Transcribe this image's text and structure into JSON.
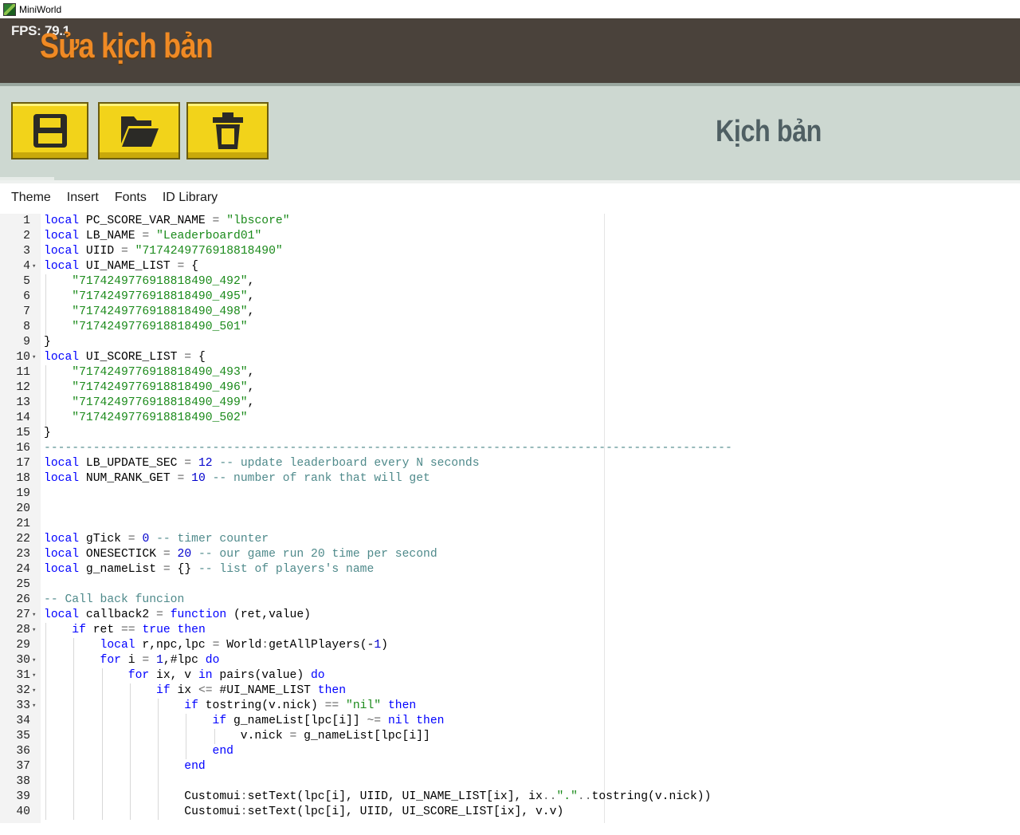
{
  "window": {
    "title": "MiniWorld"
  },
  "header": {
    "fps": "FPS: 79.1",
    "title": "Sửa kịch bản"
  },
  "toolbar": {
    "buttons": [
      {
        "name": "save",
        "icon": "floppy-disk-icon"
      },
      {
        "name": "open",
        "icon": "folder-open-icon"
      },
      {
        "name": "delete",
        "icon": "trash-icon"
      }
    ],
    "section_label": "Kịch bản"
  },
  "menu": [
    "Theme",
    "Insert",
    "Fonts",
    "ID Library"
  ],
  "colors": {
    "header_bg": "#4a423b",
    "title_orange": "#f08a24",
    "toolbar_bg": "#cdd8d1",
    "button_yellow": "#f2d31a",
    "keyword": "#0000ff",
    "string": "#1a8a1a",
    "comment": "#4f8a8b"
  },
  "code": {
    "lines": [
      {
        "n": 1,
        "fold": false,
        "text": "local PC_SCORE_VAR_NAME = \"lbscore\""
      },
      {
        "n": 2,
        "fold": false,
        "text": "local LB_NAME = \"Leaderboard01\""
      },
      {
        "n": 3,
        "fold": false,
        "text": "local UIID = \"7174249776918818490\""
      },
      {
        "n": 4,
        "fold": true,
        "text": "local UI_NAME_LIST = {"
      },
      {
        "n": 5,
        "fold": false,
        "text": "    \"7174249776918818490_492\","
      },
      {
        "n": 6,
        "fold": false,
        "text": "    \"7174249776918818490_495\","
      },
      {
        "n": 7,
        "fold": false,
        "text": "    \"7174249776918818490_498\","
      },
      {
        "n": 8,
        "fold": false,
        "text": "    \"7174249776918818490_501\""
      },
      {
        "n": 9,
        "fold": false,
        "text": "}"
      },
      {
        "n": 10,
        "fold": true,
        "text": "local UI_SCORE_LIST = {"
      },
      {
        "n": 11,
        "fold": false,
        "text": "    \"7174249776918818490_493\","
      },
      {
        "n": 12,
        "fold": false,
        "text": "    \"7174249776918818490_496\","
      },
      {
        "n": 13,
        "fold": false,
        "text": "    \"7174249776918818490_499\","
      },
      {
        "n": 14,
        "fold": false,
        "text": "    \"7174249776918818490_502\""
      },
      {
        "n": 15,
        "fold": false,
        "text": "}"
      },
      {
        "n": 16,
        "fold": false,
        "text": "--------------------------------------------------------------------------------------------------"
      },
      {
        "n": 17,
        "fold": false,
        "text": "local LB_UPDATE_SEC = 12 -- update leaderboard every N seconds"
      },
      {
        "n": 18,
        "fold": false,
        "text": "local NUM_RANK_GET = 10 -- number of rank that will get"
      },
      {
        "n": 19,
        "fold": false,
        "text": ""
      },
      {
        "n": 20,
        "fold": false,
        "text": ""
      },
      {
        "n": 21,
        "fold": false,
        "text": ""
      },
      {
        "n": 22,
        "fold": false,
        "text": "local gTick = 0 -- timer counter"
      },
      {
        "n": 23,
        "fold": false,
        "text": "local ONESECTICK = 20 -- our game run 20 time per second"
      },
      {
        "n": 24,
        "fold": false,
        "text": "local g_nameList = {} -- list of players's name"
      },
      {
        "n": 25,
        "fold": false,
        "text": ""
      },
      {
        "n": 26,
        "fold": false,
        "text": "-- Call back funcion"
      },
      {
        "n": 27,
        "fold": true,
        "text": "local callback2 = function (ret,value)"
      },
      {
        "n": 28,
        "fold": true,
        "text": "    if ret == true then"
      },
      {
        "n": 29,
        "fold": false,
        "text": "        local r,npc,lpc = World:getAllPlayers(-1)"
      },
      {
        "n": 30,
        "fold": true,
        "text": "        for i = 1,#lpc do"
      },
      {
        "n": 31,
        "fold": true,
        "text": "            for ix, v in pairs(value) do"
      },
      {
        "n": 32,
        "fold": true,
        "text": "                if ix <= #UI_NAME_LIST then"
      },
      {
        "n": 33,
        "fold": true,
        "text": "                    if tostring(v.nick) == \"nil\" then"
      },
      {
        "n": 34,
        "fold": false,
        "text": "                        if g_nameList[lpc[i]] ~= nil then"
      },
      {
        "n": 35,
        "fold": false,
        "text": "                            v.nick = g_nameList[lpc[i]]"
      },
      {
        "n": 36,
        "fold": false,
        "text": "                        end"
      },
      {
        "n": 37,
        "fold": false,
        "text": "                    end"
      },
      {
        "n": 38,
        "fold": false,
        "text": ""
      },
      {
        "n": 39,
        "fold": false,
        "text": "                    Customui:setText(lpc[i], UIID, UI_NAME_LIST[ix], ix..\".\"..tostring(v.nick))"
      },
      {
        "n": 40,
        "fold": false,
        "text": "                    Customui:setText(lpc[i], UIID, UI_SCORE_LIST[ix], v.v)"
      }
    ]
  }
}
